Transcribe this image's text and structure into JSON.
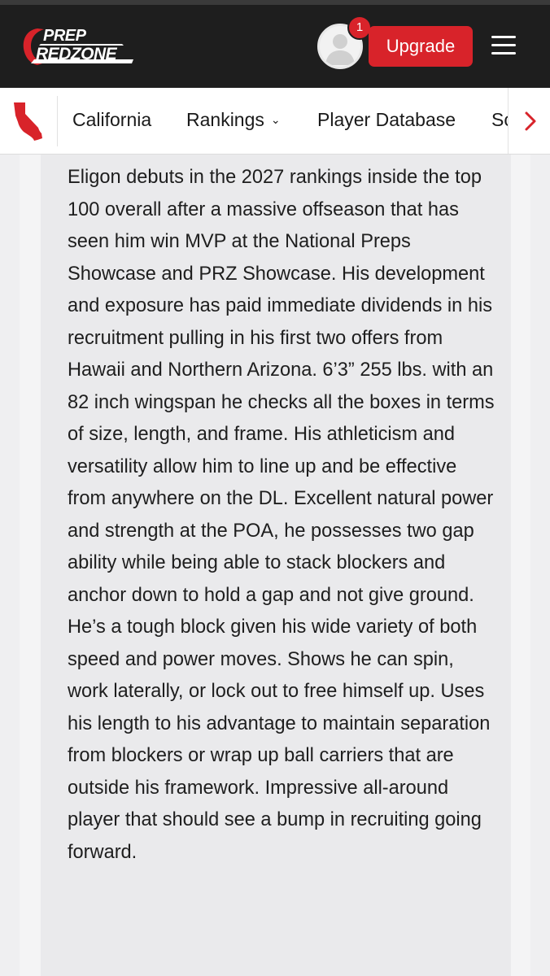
{
  "header": {
    "logo": {
      "line1": "PREP",
      "line2": "REDZONE"
    },
    "notification_count": "1",
    "upgrade_label": "Upgrade",
    "menu_icon": "hamburger-menu-icon",
    "brand_color": "#d8232a"
  },
  "subnav": {
    "state_icon": "california-state-icon",
    "items": [
      {
        "label": "California"
      },
      {
        "label": "Rankings",
        "has_dropdown": true
      },
      {
        "label": "Player Database"
      },
      {
        "label": "Sc"
      }
    ],
    "next_icon": "chevron-right-icon"
  },
  "article": {
    "body": "Eligon debuts in the 2027 rankings inside the top 100 overall after a massive offseason that has seen him win MVP at the National Preps Showcase and PRZ Showcase. His development and exposure has paid immediate dividends in his recruitment pulling in his first two offers from Hawaii and Northern Arizona. 6’3” 255 lbs. with an 82 inch wingspan he checks all the boxes in terms of size, length, and frame. His athleticism and versatility allow him to line up and be effective from anywhere on the DL. Excellent natural power and strength at the POA, he possesses two gap ability while being able to stack blockers and anchor down to hold a gap and not give ground. He’s a tough block given his wide variety of both speed and power moves. Shows he can spin, work laterally, or lock out to free himself up. Uses his length to his advantage to maintain separation from blockers or wrap up ball carriers that are outside his framework. Impressive all-around player that should see a bump in recruiting going forward."
  }
}
